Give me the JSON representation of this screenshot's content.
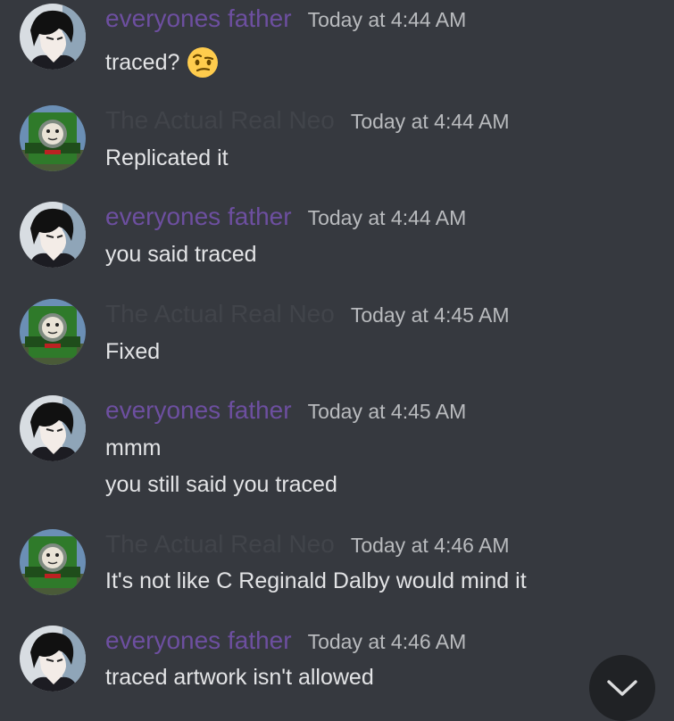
{
  "users": {
    "father": {
      "name": "everyones father",
      "color": "#6d4fa0",
      "avatar_icon": "anime-boy-avatar-icon"
    },
    "neo": {
      "name": "The Actual Real Neo",
      "color": "#41444a",
      "avatar_icon": "green-engine-avatar-icon"
    }
  },
  "messages": [
    {
      "author": "everyones father",
      "time": "Today at 4:44 AM",
      "lines": [
        "traced?"
      ],
      "emoji": "face-with-raised-eyebrow-icon"
    },
    {
      "author": "The Actual Real Neo",
      "time": "Today at 4:44 AM",
      "lines": [
        "Replicated it"
      ]
    },
    {
      "author": "everyones father",
      "time": "Today at 4:44 AM",
      "lines": [
        "you said traced"
      ]
    },
    {
      "author": "The Actual Real Neo",
      "time": "Today at 4:45 AM",
      "lines": [
        "Fixed"
      ]
    },
    {
      "author": "everyones father",
      "time": "Today at 4:45 AM",
      "lines": [
        "mmm",
        "you still said you traced"
      ]
    },
    {
      "author": "The Actual Real Neo",
      "time": "Today at 4:46 AM",
      "lines": [
        "It's not like C Reginald Dalby would mind it"
      ]
    },
    {
      "author": "everyones father",
      "time": "Today at 4:46 AM",
      "lines": [
        "traced artwork isn't allowed"
      ]
    }
  ],
  "scroll_button": {
    "icon": "chevron-down-icon"
  }
}
